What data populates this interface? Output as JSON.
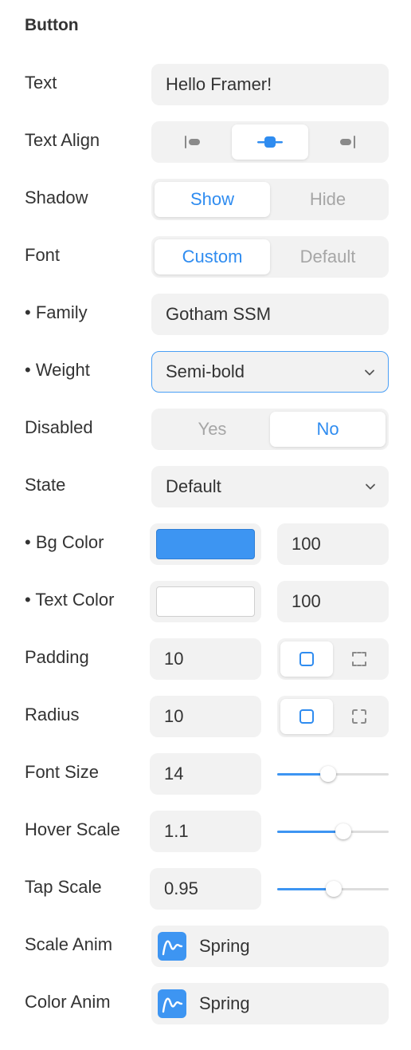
{
  "section_title": "Button",
  "labels": {
    "text": "Text",
    "text_align": "Text Align",
    "shadow": "Shadow",
    "font": "Font",
    "family": "• Family",
    "weight": "• Weight",
    "disabled": "Disabled",
    "state": "State",
    "bg_color": "• Bg Color",
    "text_color": "• Text Color",
    "padding": "Padding",
    "radius": "Radius",
    "font_size": "Font Size",
    "hover_scale": "Hover Scale",
    "tap_scale": "Tap Scale",
    "scale_anim": "Scale Anim",
    "color_anim": "Color Anim"
  },
  "values": {
    "text": "Hello Framer!",
    "text_align_selected": "center",
    "shadow": {
      "options": [
        "Show",
        "Hide"
      ],
      "selected": "Show"
    },
    "font": {
      "options": [
        "Custom",
        "Default"
      ],
      "selected": "Custom"
    },
    "family": "Gotham SSM",
    "weight": "Semi-bold",
    "disabled": {
      "options": [
        "Yes",
        "No"
      ],
      "selected": "No"
    },
    "state": "Default",
    "bg_color": {
      "color": "#3d95f2",
      "opacity": "100"
    },
    "text_color": {
      "color": "#ffffff",
      "opacity": "100"
    },
    "padding": {
      "value": "10",
      "mode_selected": "uniform"
    },
    "radius": {
      "value": "10",
      "mode_selected": "uniform"
    },
    "font_size": {
      "value": "14",
      "slider_fraction": 0.46
    },
    "hover_scale": {
      "value": "1.1",
      "slider_fraction": 0.59
    },
    "tap_scale": {
      "value": "0.95",
      "slider_fraction": 0.51
    },
    "scale_anim": "Spring",
    "color_anim": "Spring"
  },
  "icons": {
    "align_left": "align-left-icon",
    "align_center": "align-center-icon",
    "align_right": "align-right-icon",
    "uniform": "square-icon",
    "individual": "dashed-square-icon",
    "spring": "spring-curve-icon",
    "chevron": "chevron-down-icon"
  },
  "colors": {
    "accent": "#2f8cf0",
    "field_bg": "#f2f2f2"
  }
}
